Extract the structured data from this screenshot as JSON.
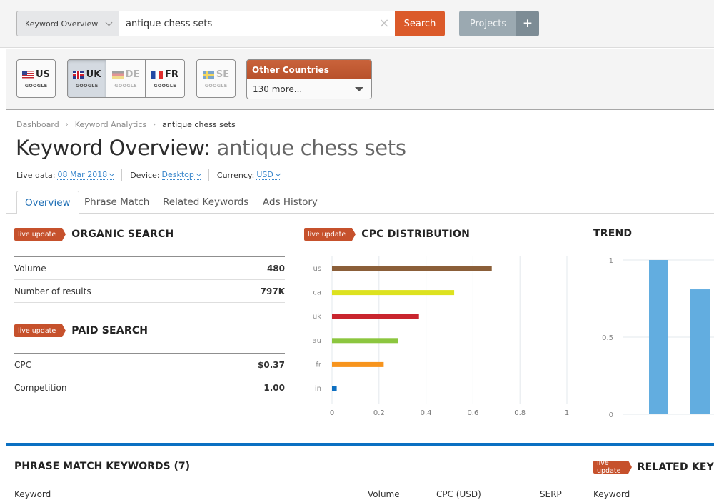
{
  "topbar": {
    "tool_select": "Keyword Overview",
    "search_value": "antique chess sets",
    "clear_icon": "×",
    "search_label": "Search",
    "projects_label": "Projects",
    "projects_add_label": "+"
  },
  "countries": {
    "items": [
      {
        "code": "US",
        "engine": "GOOGLE",
        "flag": "us-flag-icon",
        "state": "normal"
      },
      {
        "code": "UK",
        "engine": "GOOGLE",
        "flag": "uk-flag-icon",
        "state": "selected"
      },
      {
        "code": "DE",
        "engine": "GOOGLE",
        "flag": "de-flag-icon",
        "state": "disabled"
      },
      {
        "code": "FR",
        "engine": "GOOGLE",
        "flag": "fr-flag-icon",
        "state": "normal"
      },
      {
        "code": "SE",
        "engine": "GOOGLE",
        "flag": "se-flag-icon",
        "state": "disabled"
      }
    ],
    "other_title": "Other Countries",
    "other_selected": "130 more..."
  },
  "breadcrumb": {
    "items": [
      "Dashboard",
      "Keyword Analytics",
      "antique chess sets"
    ],
    "separator": "›"
  },
  "page": {
    "title_prefix": "Keyword Overview:",
    "title_keyword": " antique chess sets"
  },
  "meta": {
    "live_data_label": "Live data:",
    "live_data_value": "08 Mar 2018",
    "device_label": "Device:",
    "device_value": "Desktop",
    "currency_label": "Currency:",
    "currency_value": "USD"
  },
  "tabs": [
    {
      "label": "Overview",
      "active": true
    },
    {
      "label": "Phrase Match",
      "active": false
    },
    {
      "label": "Related Keywords",
      "active": false
    },
    {
      "label": "Ads History",
      "active": false
    }
  ],
  "badge_label": "live update",
  "organic": {
    "title": "ORGANIC SEARCH",
    "rows": [
      {
        "label": "Volume",
        "value": "480"
      },
      {
        "label": "Number of results",
        "value": "797K"
      }
    ]
  },
  "paid": {
    "title": "PAID SEARCH",
    "rows": [
      {
        "label": "CPC",
        "value": "$0.37"
      },
      {
        "label": "Competition",
        "value": "1.00"
      }
    ]
  },
  "chart_data": [
    {
      "type": "bar",
      "orientation": "horizontal",
      "title": "CPC DISTRIBUTION",
      "categories": [
        "us",
        "ca",
        "uk",
        "au",
        "fr",
        "in"
      ],
      "values": [
        0.68,
        0.52,
        0.37,
        0.28,
        0.22,
        0.02
      ],
      "colors": [
        "#8b5f39",
        "#dde21f",
        "#c9252e",
        "#8cc63f",
        "#f7941d",
        "#0d6fc1"
      ],
      "xlim": [
        0,
        1
      ],
      "xticks": [
        "0",
        "0.2",
        "0.4",
        "0.6",
        "0.8",
        "1"
      ],
      "grid": true,
      "xlabel": "",
      "ylabel": ""
    },
    {
      "type": "bar",
      "title": "TREND",
      "values": [
        1.0,
        0.81
      ],
      "color": "#62ade0",
      "ylim": [
        0,
        1
      ],
      "yticks": [
        "0",
        "0.5",
        "1"
      ],
      "grid": true,
      "xlabel": "",
      "ylabel": ""
    }
  ],
  "phrase_match": {
    "title": "PHRASE MATCH KEYWORDS (7)",
    "columns": [
      "Keyword",
      "Volume",
      "CPC (USD)",
      "SERP"
    ]
  },
  "related": {
    "title": "RELATED KEY",
    "columns": [
      "Keyword"
    ]
  }
}
